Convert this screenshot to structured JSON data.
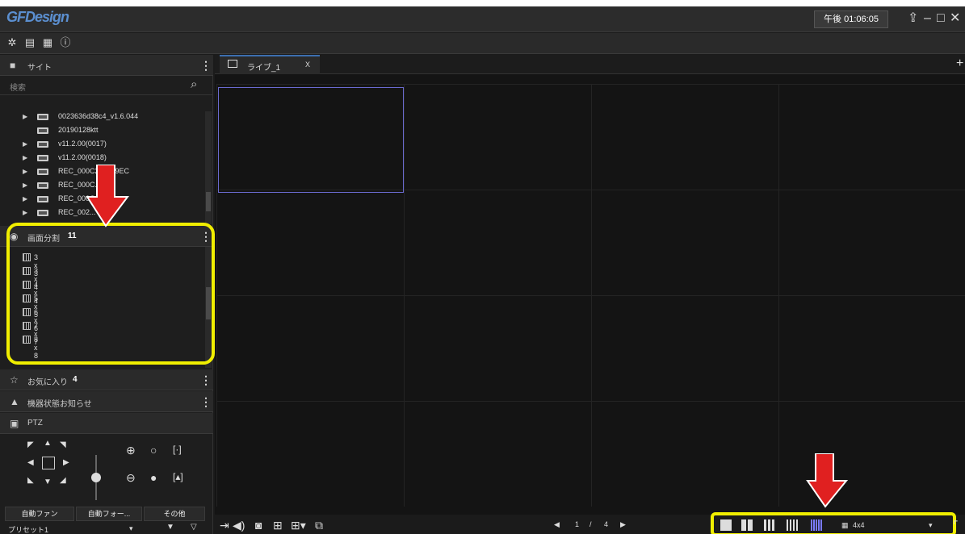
{
  "app": {
    "logo": "GFDesign",
    "clock": "午後 01:06:05"
  },
  "toolbar": {
    "icons": [
      "gear-icon",
      "schedule-icon",
      "grid-icon",
      "info-icon"
    ]
  },
  "site_panel": {
    "title": "サイト",
    "search_placeholder": "検索",
    "items": [
      {
        "label": "0023636d38c4_v1.6.044",
        "expandable": true
      },
      {
        "label": "20190128ktt",
        "expandable": false
      },
      {
        "label": "v11.2.00(0017)",
        "expandable": true
      },
      {
        "label": "v11.2.00(0018)",
        "expandable": true
      },
      {
        "label": "REC_000C280059EC",
        "expandable": true
      },
      {
        "label": "REC_000C...E8C",
        "expandable": true
      },
      {
        "label": "REC_000C...",
        "expandable": true
      },
      {
        "label": "REC_002...",
        "expandable": true
      }
    ]
  },
  "split_panel": {
    "title": "画面分割",
    "count": "11",
    "items": [
      "3 x 3",
      "3 x 4",
      "4 x 4",
      "5 x 5",
      "6 x 6",
      "7 x 7",
      "8 x 8"
    ]
  },
  "favorites": {
    "title": "お気に入り",
    "count": "4"
  },
  "notifications": {
    "title": "機器状態お知らせ"
  },
  "ptz": {
    "title": "PTZ",
    "buttons": [
      "自動ファン",
      "自動フォー...",
      "その他"
    ],
    "preset": "プリセット1"
  },
  "main": {
    "tab_label": "ライブ_1",
    "tab_close": "X",
    "pager": {
      "current": "1",
      "separator": "/",
      "total": "4"
    },
    "layout_select": "4x4"
  },
  "colors": {
    "highlight": "#f0ee00",
    "arrow": "#e02020",
    "accent": "#3c6fb0"
  }
}
